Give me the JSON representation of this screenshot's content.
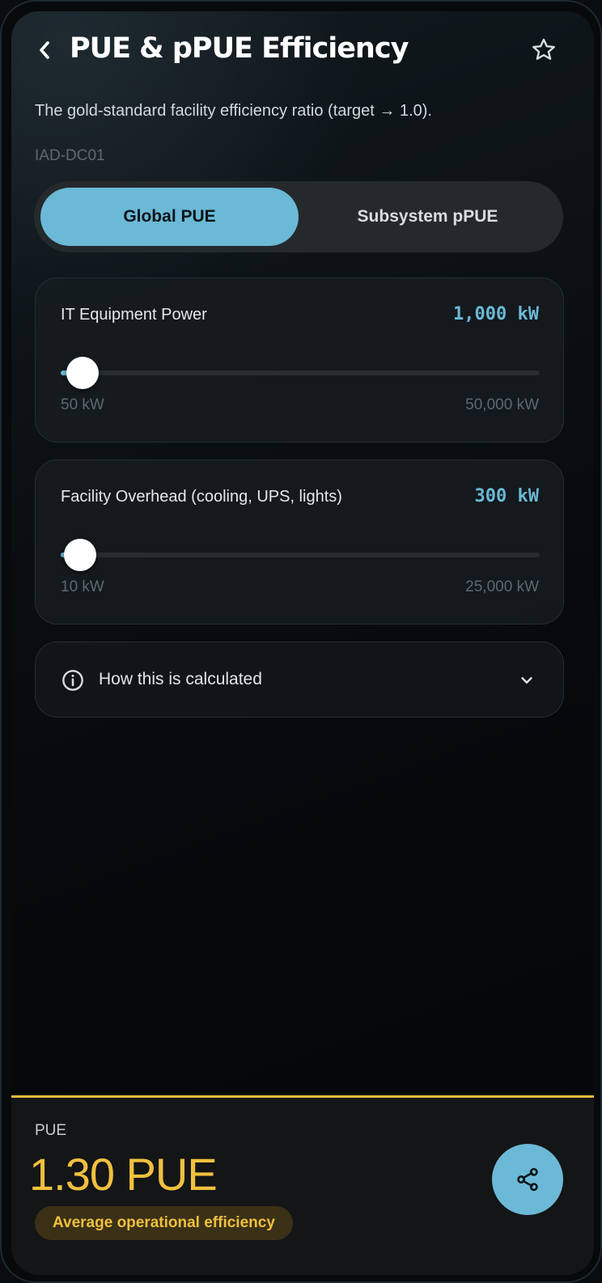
{
  "header": {
    "title": "PUE & pPUE Efficiency",
    "back_icon": "chevron-left-icon",
    "favorite_icon": "star-outline-icon"
  },
  "subtitle": "The gold-standard facility efficiency ratio (target → 1.0).",
  "site": "IAD-DC01",
  "tabs": [
    {
      "label": "Global PUE",
      "active": true
    },
    {
      "label": "Subsystem pPUE",
      "active": false
    }
  ],
  "inputs": [
    {
      "label": "IT Equipment Power",
      "value_text": "1,000 kW",
      "value": 1000,
      "min": 50,
      "max": 50000,
      "min_label": "50 kW",
      "max_label": "50,000 kW",
      "display_fraction": 0.045
    },
    {
      "label": "Facility Overhead (cooling, UPS, lights)",
      "value_text": "300 kW",
      "value": 300,
      "min": 10,
      "max": 25000,
      "min_label": "10 kW",
      "max_label": "25,000 kW",
      "display_fraction": 0.04
    }
  ],
  "calc_info": {
    "label": "How this is calculated",
    "icon": "info-circle-icon",
    "expand_icon": "chevron-down-icon"
  },
  "result": {
    "label": "PUE",
    "value": "1.30 PUE",
    "badge": "Average operational efficiency",
    "share_icon": "share-icon"
  },
  "colors": {
    "accent": "#6bb9d6",
    "result": "#f0c03e",
    "badge_bg": "#3a3016"
  }
}
